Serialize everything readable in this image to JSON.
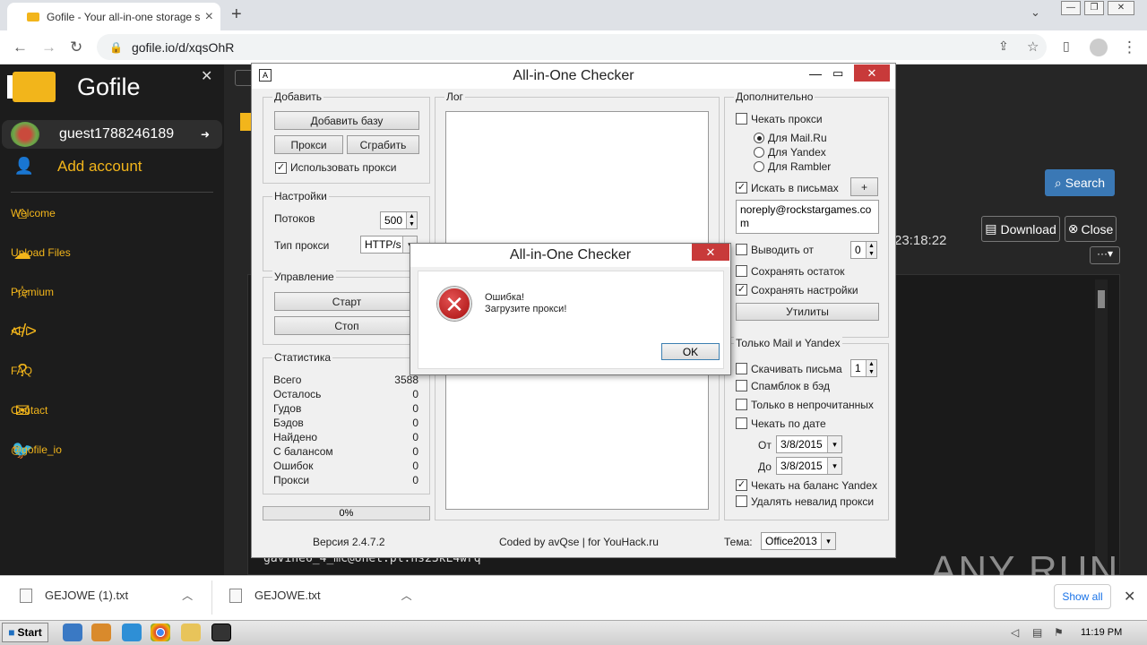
{
  "browser": {
    "tab_title": "Gofile - Your all-in-one storage soluti",
    "url": "gofile.io/d/xqsOhR"
  },
  "gofile": {
    "brand": "Gofile",
    "username": "guest1788246189",
    "add_account": "Add account",
    "nav": [
      {
        "label": "Welcome",
        "icon": "home-icon"
      },
      {
        "label": "Upload Files",
        "icon": "upload-icon"
      },
      {
        "label": "Premium",
        "icon": "star-icon"
      },
      {
        "label": "API",
        "icon": "code-icon"
      },
      {
        "label": "FAQ",
        "icon": "question-icon"
      },
      {
        "label": "Contact",
        "icon": "mail-icon"
      },
      {
        "label": "@gofile_io",
        "icon": "twitter-icon"
      }
    ],
    "search_label": "Search",
    "download_label": "Download",
    "close_label": "Close",
    "time_text": "23:18:22",
    "viewer_text": "gavine6_4_mc@onet.pl:hs23kL4wrq",
    "brand_color": "#f2b51b"
  },
  "checker": {
    "title": "All-in-One Checker",
    "add_group": "Добавить",
    "add_base": "Добавить базу",
    "proxy_btn": "Прокси",
    "grab_btn": "Сграбить",
    "use_proxy": "Использовать прокси",
    "settings_group": "Настройки",
    "threads_label": "Потоков",
    "threads_value": "500",
    "proxy_type_label": "Тип прокси",
    "proxy_type_value": "HTTP/s",
    "control_group": "Управление",
    "start_btn": "Старт",
    "stop_btn": "Стоп",
    "stats_group": "Статистика",
    "stats": [
      {
        "label": "Всего",
        "value": "3588"
      },
      {
        "label": "Осталось",
        "value": "0"
      },
      {
        "label": "Гудов",
        "value": "0"
      },
      {
        "label": "Бэдов",
        "value": "0"
      },
      {
        "label": "Найдено",
        "value": "0"
      },
      {
        "label": "С балансом",
        "value": "0"
      },
      {
        "label": "Ошибок",
        "value": "0"
      },
      {
        "label": "Прокси",
        "value": "0"
      }
    ],
    "progress_text": "0%",
    "log_group": "Лог",
    "extra_group": "Дополнительно",
    "check_proxy": "Чекать прокси",
    "for_mailru": "Для Mail.Ru",
    "for_yandex": "Для Yandex",
    "for_rambler": "Для Rambler",
    "search_letters": "Искать в письмах",
    "plus": "+",
    "search_value": "noreply@rockstargames.com",
    "output_from": "Выводить от",
    "output_from_value": "0",
    "save_rest": "Сохранять остаток",
    "save_settings": "Сохранять настройки",
    "utilities": "Утилиты",
    "mail_yandex_group": "Только Mail и Yandex",
    "download_letters": "Скачивать письма",
    "download_letters_value": "1",
    "spamblock": "Спамблок в бэд",
    "only_unread": "Только в непрочитанных",
    "check_by_date": "Чекать по дате",
    "from_label": "От",
    "from_date": "3/8/2015",
    "to_label": "До",
    "to_date": "3/8/2015",
    "check_balance": "Чекать на баланс Yandex",
    "delete_invalid": "Удалять невалид прокси",
    "version": "Версия 2.4.7.2",
    "coded_by": "Coded by avQse | for YouHack.ru",
    "theme_label": "Тема:",
    "theme_value": "Office2013"
  },
  "dialog": {
    "title": "All-in-One Checker",
    "line1": "Ошибка!",
    "line2": "Загрузите прокси!",
    "ok": "OK"
  },
  "downloads": {
    "items": [
      "GEJOWE (1).txt",
      "GEJOWE.txt"
    ],
    "show_all": "Show all"
  },
  "taskbar": {
    "start": "Start",
    "clock": "11:19 PM"
  },
  "watermark": "ANY RUN"
}
